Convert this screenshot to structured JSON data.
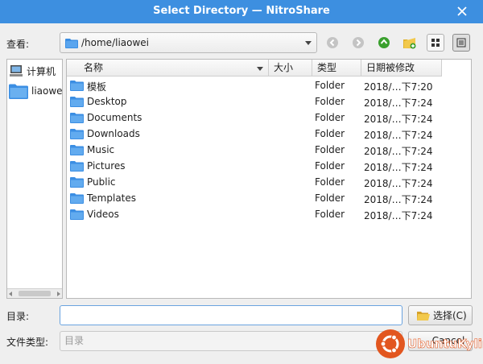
{
  "window": {
    "title": "Select Directory — NitroShare",
    "titlebar_color": "#3d8fe0"
  },
  "toolbar": {
    "look_in_label": "查看:",
    "path": "/home/liaowei",
    "buttons": [
      "back-icon",
      "forward-icon",
      "parent-dir-icon",
      "new-folder-icon",
      "list-view-icon",
      "detail-view-icon"
    ]
  },
  "sidebar": {
    "items": [
      {
        "label": "计算机",
        "icon": "computer-icon"
      },
      {
        "label": "liaowei",
        "icon": "folder-icon"
      }
    ]
  },
  "filelist": {
    "columns": [
      "名称",
      "大小",
      "类型",
      "日期被修改"
    ],
    "rows": [
      {
        "name": "模板",
        "type": "Folder",
        "date": "2018/…下7:20"
      },
      {
        "name": "Desktop",
        "type": "Folder",
        "date": "2018/…下7:24"
      },
      {
        "name": "Documents",
        "type": "Folder",
        "date": "2018/…下7:24"
      },
      {
        "name": "Downloads",
        "type": "Folder",
        "date": "2018/…下7:24"
      },
      {
        "name": "Music",
        "type": "Folder",
        "date": "2018/…下7:24"
      },
      {
        "name": "Pictures",
        "type": "Folder",
        "date": "2018/…下7:24"
      },
      {
        "name": "Public",
        "type": "Folder",
        "date": "2018/…下7:24"
      },
      {
        "name": "Templates",
        "type": "Folder",
        "date": "2018/…下7:24"
      },
      {
        "name": "Videos",
        "type": "Folder",
        "date": "2018/…下7:24"
      }
    ]
  },
  "footer": {
    "directory_label": "目录:",
    "directory_value": "",
    "choose_label": "选择(C)",
    "file_type_label": "文件类型:",
    "file_type_value": "目录",
    "cancel_label": "Cancel"
  },
  "watermark": {
    "text": "UbuntuKylin",
    "color": "#e2561f"
  },
  "colors": {
    "folder": "#3b8ee3",
    "accent": "#3d8fe0"
  }
}
